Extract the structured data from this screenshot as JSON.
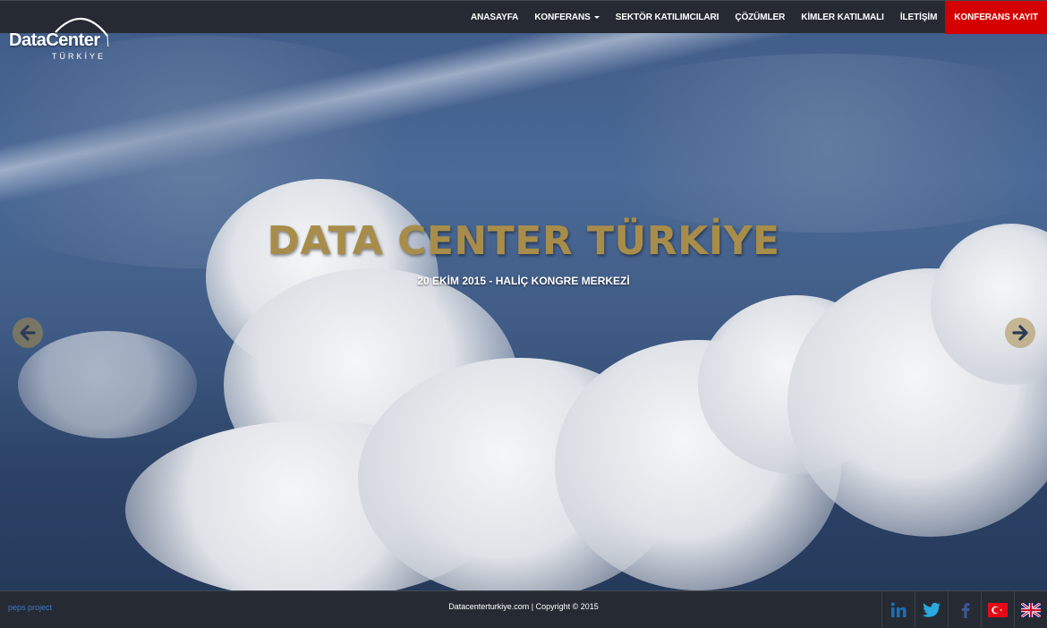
{
  "logo": {
    "main": "DataCenter",
    "sub": "TÜRKİYE"
  },
  "nav": {
    "items": [
      {
        "label": "ANASAYFA"
      },
      {
        "label": "KONFERANS",
        "dropdown": true
      },
      {
        "label": "SEKTÖR KATILIMCILARI"
      },
      {
        "label": "ÇÖZÜMLER"
      },
      {
        "label": "KİMLER KATILMALI"
      },
      {
        "label": "İLETİŞİM"
      },
      {
        "label": "KONFERANS KAYIT",
        "highlight": true
      }
    ]
  },
  "hero": {
    "title": "DATA CENTER TÜRKİYE",
    "subtitle": "20 EKİM 2015 - HALİÇ KONGRE MERKEZİ",
    "prev_icon": "arrow-left-icon",
    "next_icon": "arrow-right-icon"
  },
  "footer": {
    "left_link": "peps project",
    "copyright": "Datacenterturkiye.com | Copyright © 2015",
    "social": [
      "linkedin-icon",
      "twitter-icon",
      "facebook-icon",
      "turkish-flag-icon",
      "uk-flag-icon"
    ]
  },
  "colors": {
    "nav_bg": "#262b33",
    "cta_bg": "#d40000",
    "title_gold": "#a88d4a",
    "link_blue": "#3a79c6",
    "linkedin": "#1a6fb5",
    "twitter": "#2aa9e0",
    "facebook": "#3b5998"
  }
}
